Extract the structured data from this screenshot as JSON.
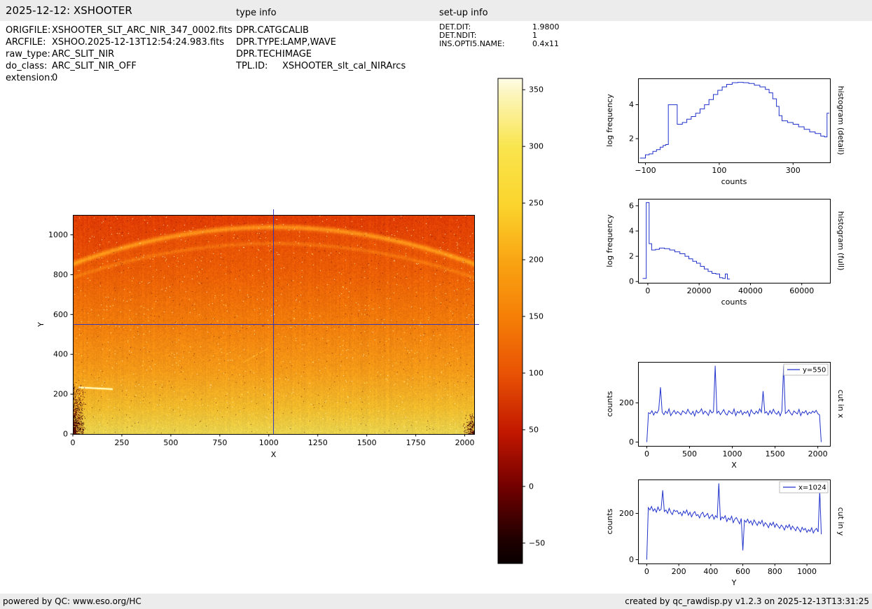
{
  "header": {
    "title": "2025-12-12: XSHOOTER",
    "type_info_label": "type info",
    "setup_info_label": "set-up info"
  },
  "file_info": {
    "rows": [
      {
        "label": "ORIGFILE:",
        "value": "XSHOOTER_SLT_ARC_NIR_347_0002.fits"
      },
      {
        "label": "ARCFILE:",
        "value": "XSHOO.2025-12-13T12:54:24.983.fits"
      },
      {
        "label": "raw_type:",
        "value": "ARC_SLIT_NIR"
      },
      {
        "label": "do_class:",
        "value": "ARC_SLIT_NIR_OFF"
      },
      {
        "label": "extension:",
        "value": "0"
      }
    ]
  },
  "type_info": {
    "rows": [
      {
        "label": "DPR.CATG:",
        "value": "CALIB"
      },
      {
        "label": "DPR.TYPE:",
        "value": "LAMP,WAVE"
      },
      {
        "label": "DPR.TECH:",
        "value": "IMAGE"
      },
      {
        "label": "TPL.ID:",
        "value": "XSHOOTER_slt_cal_NIRArcs"
      }
    ]
  },
  "setup_info": {
    "rows": [
      {
        "label": "DET.DIT:",
        "value": "1.9800"
      },
      {
        "label": "DET.NDIT:",
        "value": "1"
      },
      {
        "label": "INS.OPTI5.NAME:",
        "value": "0.4x11"
      }
    ]
  },
  "footer": {
    "left": "powered by QC: www.eso.org/HC",
    "right": "created by qc_rawdisp.py v1.2.3 on 2025-12-13T13:31:25"
  },
  "chart_data": [
    {
      "id": "main_image",
      "type": "heatmap",
      "xlabel": "X",
      "ylabel": "Y",
      "xlim": [
        0,
        2048
      ],
      "ylim": [
        0,
        1100
      ],
      "xticks": [
        0,
        250,
        500,
        750,
        1000,
        1250,
        1500,
        1750,
        2000
      ],
      "yticks": [
        0,
        200,
        400,
        600,
        800,
        1000
      ],
      "crosshair": {
        "x": 1024,
        "y": 550,
        "color": "#2233cc"
      },
      "gradient_stops": [
        {
          "y": 0,
          "color": "#e9d44f"
        },
        {
          "y": 130,
          "color": "#f0bb2c"
        },
        {
          "y": 320,
          "color": "#f49a18"
        },
        {
          "y": 560,
          "color": "#f17c0b"
        },
        {
          "y": 820,
          "color": "#eb5d05"
        },
        {
          "y": 1100,
          "color": "#e44604"
        }
      ],
      "arcs": [
        {
          "apex_y": 1038,
          "sag": 185,
          "sigma": 9,
          "boost": 68
        },
        {
          "apex_y": 956,
          "sag": 170,
          "sigma": 7,
          "boost": 28
        }
      ],
      "description": "2048x1100 NIR detector arc-lamp exposure; counts decrease from bottom (yellow ~230) to top (red ~120); two bright curved arc bands near the top; dark bad-pixel clusters in bottom-left and bottom-right corners; bright streak near (100,230); blue crosshair at x=1024, y=550"
    },
    {
      "id": "colorbar",
      "type": "colorbar",
      "vmin": -68,
      "vmax": 360,
      "ticks": [
        {
          "value": 350,
          "label": "350"
        },
        {
          "value": 300,
          "label": "300"
        },
        {
          "value": 250,
          "label": "250"
        },
        {
          "value": 200,
          "label": "200"
        },
        {
          "value": 150,
          "label": "150"
        },
        {
          "value": 100,
          "label": "100"
        },
        {
          "value": 50,
          "label": "50"
        },
        {
          "value": 0,
          "label": "0"
        },
        {
          "value": -50,
          "label": "−50"
        }
      ],
      "colormap": [
        {
          "pos": 0.0,
          "color": "#0a0000"
        },
        {
          "pos": 0.05,
          "color": "#200000"
        },
        {
          "pos": 0.16,
          "color": "#740000"
        },
        {
          "pos": 0.27,
          "color": "#c21700"
        },
        {
          "pos": 0.39,
          "color": "#e85204"
        },
        {
          "pos": 0.5,
          "color": "#f57c06"
        },
        {
          "pos": 0.62,
          "color": "#f9a312"
        },
        {
          "pos": 0.74,
          "color": "#fbd52d"
        },
        {
          "pos": 0.86,
          "color": "#f9e54e"
        },
        {
          "pos": 0.97,
          "color": "#fdf6bf"
        },
        {
          "pos": 1.0,
          "color": "#fefce8"
        }
      ]
    },
    {
      "id": "hist_detail",
      "type": "line",
      "style": "step",
      "right_label": "histogram (detail)",
      "xlabel": "counts",
      "ylabel": "log frequency",
      "xlim": [
        -120,
        400
      ],
      "ylim": [
        0.6,
        5.55
      ],
      "xticks": [
        -100,
        100,
        300
      ],
      "yticks": [
        2,
        4
      ],
      "line_color": "#2233cc",
      "x": [
        -115,
        -100,
        -90,
        -80,
        -70,
        -60,
        -52,
        -45,
        -38,
        -14,
        0,
        12,
        24,
        36,
        48,
        60,
        72,
        84,
        96,
        108,
        120,
        135,
        150,
        165,
        180,
        195,
        210,
        225,
        235,
        245,
        255,
        262,
        270,
        285,
        300,
        315,
        330,
        345,
        360,
        375,
        385,
        392,
        398
      ],
      "y": [
        0.85,
        1.05,
        1.1,
        1.25,
        1.35,
        1.5,
        1.6,
        1.65,
        4.0,
        2.85,
        2.95,
        3.15,
        3.3,
        3.5,
        3.75,
        4.0,
        4.3,
        4.6,
        4.85,
        5.05,
        5.2,
        5.3,
        5.32,
        5.3,
        5.25,
        5.15,
        5.05,
        4.9,
        4.7,
        4.35,
        3.9,
        3.35,
        3.05,
        2.95,
        2.85,
        2.7,
        2.55,
        2.4,
        2.3,
        2.15,
        2.1,
        3.5,
        3.5
      ]
    },
    {
      "id": "hist_full",
      "type": "line",
      "style": "step",
      "right_label": "histogram (full)",
      "xlabel": "counts",
      "ylabel": "log frequency",
      "xlim": [
        -3800,
        71000
      ],
      "ylim": [
        -0.1,
        6.55
      ],
      "xticks": [
        0,
        20000,
        40000,
        60000
      ],
      "yticks": [
        0,
        2,
        4,
        6
      ],
      "line_color": "#2233cc",
      "x": [
        -2000,
        -600,
        500,
        1500,
        3000,
        4500,
        6500,
        8500,
        10500,
        12500,
        14500,
        16000,
        17500,
        19000,
        20500,
        22000,
        23500,
        25000,
        26500,
        28000,
        29200,
        30200,
        31000,
        32000
      ],
      "y": [
        0.25,
        6.25,
        3.0,
        2.5,
        2.55,
        2.65,
        2.6,
        2.5,
        2.35,
        2.2,
        2.0,
        1.8,
        1.6,
        1.45,
        1.2,
        1.0,
        0.8,
        0.65,
        0.6,
        0.3,
        0.25,
        0.6,
        0.2,
        0.2
      ]
    },
    {
      "id": "cut_x",
      "type": "line",
      "right_label": "cut in x",
      "xlabel": "X",
      "ylabel": "counts",
      "legend": "y=550",
      "legend_position": "upper right",
      "xlim": [
        -102,
        2142
      ],
      "ylim": [
        -19.5,
        409.5
      ],
      "xticks": [
        0,
        500,
        1000,
        1500,
        2000
      ],
      "yticks": [
        0,
        200
      ],
      "line_color": "#2233cc",
      "x_start": 0,
      "x_step": 20,
      "values": [
        0,
        150,
        145,
        160,
        138,
        155,
        148,
        165,
        280,
        152,
        140,
        158,
        146,
        170,
        135,
        150,
        162,
        144,
        156,
        148,
        139,
        160,
        152,
        145,
        168,
        150,
        141,
        157,
        133,
        162,
        148,
        155,
        170,
        143,
        158,
        150,
        136,
        164,
        149,
        155,
        390,
        147,
        158,
        140,
        152,
        166,
        145,
        138,
        160,
        151,
        144,
        169,
        135,
        156,
        148,
        162,
        140,
        154,
        147,
        159,
        132,
        165,
        150,
        143,
        158,
        146,
        170,
        152,
        260,
        148,
        155,
        139,
        161,
        145,
        168,
        150,
        142,
        157,
        134,
        160,
        390,
        146,
        152,
        165,
        148,
        138,
        159,
        151,
        144,
        167,
        135,
        155,
        148,
        161,
        140,
        153,
        146,
        158,
        150,
        162,
        145,
        139,
        0
      ]
    },
    {
      "id": "cut_y",
      "type": "line",
      "right_label": "cut in y",
      "xlabel": "Y",
      "ylabel": "counts",
      "legend": "x=1024",
      "legend_position": "upper right",
      "xlim": [
        -54,
        1144
      ],
      "ylim": [
        -16.5,
        346.5
      ],
      "xticks": [
        0,
        200,
        400,
        600,
        800,
        1000
      ],
      "yticks": [
        0,
        200
      ],
      "line_color": "#2233cc",
      "x_start": 0,
      "x_step": 10,
      "values": [
        0,
        225,
        215,
        230,
        210,
        220,
        205,
        228,
        212,
        218,
        300,
        208,
        215,
        200,
        222,
        205,
        195,
        215,
        208,
        212,
        198,
        205,
        190,
        210,
        200,
        215,
        192,
        205,
        185,
        200,
        208,
        190,
        195,
        180,
        198,
        205,
        185,
        192,
        200,
        178,
        188,
        195,
        175,
        190,
        182,
        330,
        170,
        185,
        178,
        190,
        165,
        180,
        172,
        188,
        160,
        175,
        182,
        168,
        155,
        178,
        40,
        170,
        162,
        175,
        158,
        168,
        150,
        172,
        160,
        148,
        165,
        155,
        170,
        145,
        160,
        152,
        138,
        158,
        148,
        162,
        140,
        155,
        145,
        135,
        150,
        142,
        128,
        148,
        138,
        152,
        130,
        145,
        135,
        125,
        142,
        132,
        120,
        140,
        128,
        135,
        118,
        130,
        122,
        138,
        115,
        128,
        135,
        120,
        300,
        110
      ]
    }
  ]
}
